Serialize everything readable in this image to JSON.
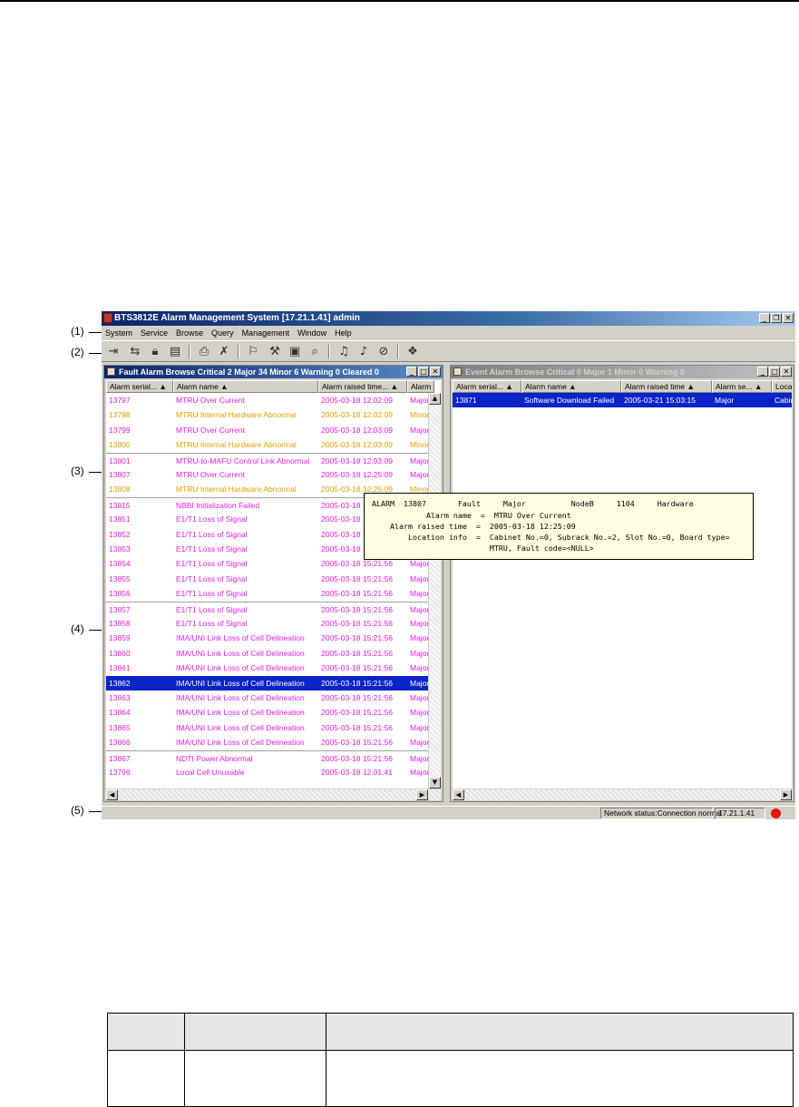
{
  "app": {
    "title": "BTS3812E Alarm Management System  [17.21.1.41] admin",
    "menu": [
      "System",
      "Service",
      "Browse",
      "Query",
      "Management",
      "Window",
      "Help"
    ]
  },
  "callouts": [
    "(1)",
    "(2)",
    "(3)",
    "(4)",
    "(5)"
  ],
  "toolbar_icons": [
    "logout-icon",
    "swap-user-icon",
    "lock-icon",
    "select-icon",
    "print-icon",
    "print-cancel-icon",
    "filter-icon",
    "tools-icon",
    "export-icon",
    "find-icon",
    "bell-icon",
    "mute-icon",
    "mute-all-icon",
    "help-book-icon"
  ],
  "fault_panel": {
    "title": "Fault Alarm Browse  Critical 2  Major 34  Minor 6  Warning 0  Cleared 0",
    "columns": [
      "Alarm serial...  ▲",
      "Alarm name   ▲",
      "Alarm raised time...   ▲",
      "Alarm s"
    ],
    "rows": [
      {
        "serial": "13797",
        "name": "MTRU Over Current",
        "time": "2005-03-18 12:02:09",
        "sev": "Major",
        "color": "#e020e0"
      },
      {
        "serial": "13798",
        "name": "MTRU Internal Hardware Abnormal",
        "time": "2005-03-18 12:02:09",
        "sev": "Minor",
        "color": "#e0a000"
      },
      {
        "serial": "13799",
        "name": "MTRU Over Current",
        "time": "2005-03-18 12:03:09",
        "sev": "Major",
        "color": "#e020e0"
      },
      {
        "serial": "13800",
        "name": "MTRU Internal Hardware Abnormal",
        "time": "2005-03-18 12:03:09",
        "sev": "Minor",
        "color": "#e0a000"
      },
      {
        "serial": "13801",
        "name": "MTRU-to-MAFU Control Link Abnormal",
        "time": "2005-03-18 12:03:09",
        "sev": "Major",
        "color": "#e020e0"
      },
      {
        "serial": "13807",
        "name": "MTRU Over Current",
        "time": "2005-03-18 12:25:09",
        "sev": "Major",
        "color": "#e020e0"
      },
      {
        "serial": "13808",
        "name": "MTRU Internal Hardware Abnormal",
        "time": "2005-03-18 12:25:09",
        "sev": "Minor",
        "color": "#e0a000"
      },
      {
        "serial": "13815",
        "name": "NBBI Initialization Failed",
        "time": "2005-03-18",
        "sev": "",
        "color": "#e020e0"
      },
      {
        "serial": "13851",
        "name": "E1/T1 Loss of Signal",
        "time": "2005-03-18",
        "sev": "",
        "color": "#e020e0"
      },
      {
        "serial": "13852",
        "name": "E1/T1 Loss of Signal",
        "time": "2005-03-18",
        "sev": "",
        "color": "#e020e0"
      },
      {
        "serial": "13853",
        "name": "E1/T1 Loss of Signal",
        "time": "2005-03-18",
        "sev": "",
        "color": "#e020e0"
      },
      {
        "serial": "13854",
        "name": "E1/T1 Loss of Signal",
        "time": "2005-03-18 15:21:56",
        "sev": "Major",
        "color": "#e020e0"
      },
      {
        "serial": "13855",
        "name": "E1/T1 Loss of Signal",
        "time": "2005-03-18 15:21:56",
        "sev": "Major",
        "color": "#e020e0"
      },
      {
        "serial": "13856",
        "name": "E1/T1 Loss of Signal",
        "time": "2005-03-18 15:21:56",
        "sev": "Major",
        "color": "#e020e0"
      },
      {
        "serial": "13857",
        "name": "E1/T1 Loss of Signal",
        "time": "2005-03-18 15:21:56",
        "sev": "Major",
        "color": "#e020e0"
      },
      {
        "serial": "13858",
        "name": "E1/T1 Loss of Signal",
        "time": "2005-03-18 15:21:56",
        "sev": "Major",
        "color": "#e020e0"
      },
      {
        "serial": "13859",
        "name": "IMA/UNI Link Loss of Cell Delineation",
        "time": "2005-03-18 15:21:56",
        "sev": "Major",
        "color": "#e020e0"
      },
      {
        "serial": "13860",
        "name": "IMA/UNI Link Loss of Cell Delineation",
        "time": "2005-03-18 15:21:56",
        "sev": "Major",
        "color": "#e020e0"
      },
      {
        "serial": "13861",
        "name": "IMA/UNI Link Loss of Cell Delineation",
        "time": "2005-03-18 15:21:56",
        "sev": "Major",
        "color": "#e020e0"
      },
      {
        "serial": "13862",
        "name": "IMA/UNI Link Loss of Cell Delineation",
        "time": "2005-03-18 15:21:56",
        "sev": "Major",
        "color": "#e020e0"
      },
      {
        "serial": "13863",
        "name": "IMA/UNI Link Loss of Cell Delineation",
        "time": "2005-03-18 15:21:56",
        "sev": "Major",
        "color": "#e020e0"
      },
      {
        "serial": "13864",
        "name": "IMA/UNI Link Loss of Cell Delineation",
        "time": "2005-03-18 15:21:56",
        "sev": "Major",
        "color": "#e020e0"
      },
      {
        "serial": "13865",
        "name": "IMA/UNI Link Loss of Cell Delineation",
        "time": "2005-03-18 15:21:56",
        "sev": "Major",
        "color": "#e020e0"
      },
      {
        "serial": "13866",
        "name": "IMA/UNI Link Loss of Cell Delineation",
        "time": "2005-03-18 15:21:56",
        "sev": "Major",
        "color": "#e020e0"
      },
      {
        "serial": "13867",
        "name": "NDTI Power Abnormal",
        "time": "2005-03-18 15:21:56",
        "sev": "Major",
        "color": "#e020e0"
      },
      {
        "serial": "13796",
        "name": "Local Cell Unusable",
        "time": "2005-03-18 12:01:41",
        "sev": "Major",
        "color": "#e020e0"
      }
    ],
    "selected_serial": "13862"
  },
  "event_panel": {
    "title": "Event Alarm Browse  Critical 0  Major 1  Minor 0  Warning 0",
    "columns": [
      "Alarm serial...  ▲",
      "Alarm name   ▲",
      "Alarm raised time   ▲",
      "Alarm se...  ▲",
      "Loca"
    ],
    "rows": [
      {
        "serial": "13871",
        "name": "Software Download Failed",
        "time": "2005-03-21 15:03:15",
        "sev": "Major",
        "loc": "Cabin"
      }
    ]
  },
  "tooltip": {
    "line1": "ALARM  13807       Fault     Major          NodeB     1104     Hardware",
    "line2": "            Alarm name  =  MTRU Over Current",
    "line3": "    Alarm raised time  =  2005-03-18 12:25:09",
    "line4": "        Location info  =  Cabinet No.=0, Subrack No.=2, Slot No.=0, Board type=",
    "line5": "                          MTRU, Fault code=<NULL>"
  },
  "statusbar": {
    "network": "Network status:Connection normal",
    "ip": "17.21.1.41",
    "led_color": "#e81818"
  }
}
